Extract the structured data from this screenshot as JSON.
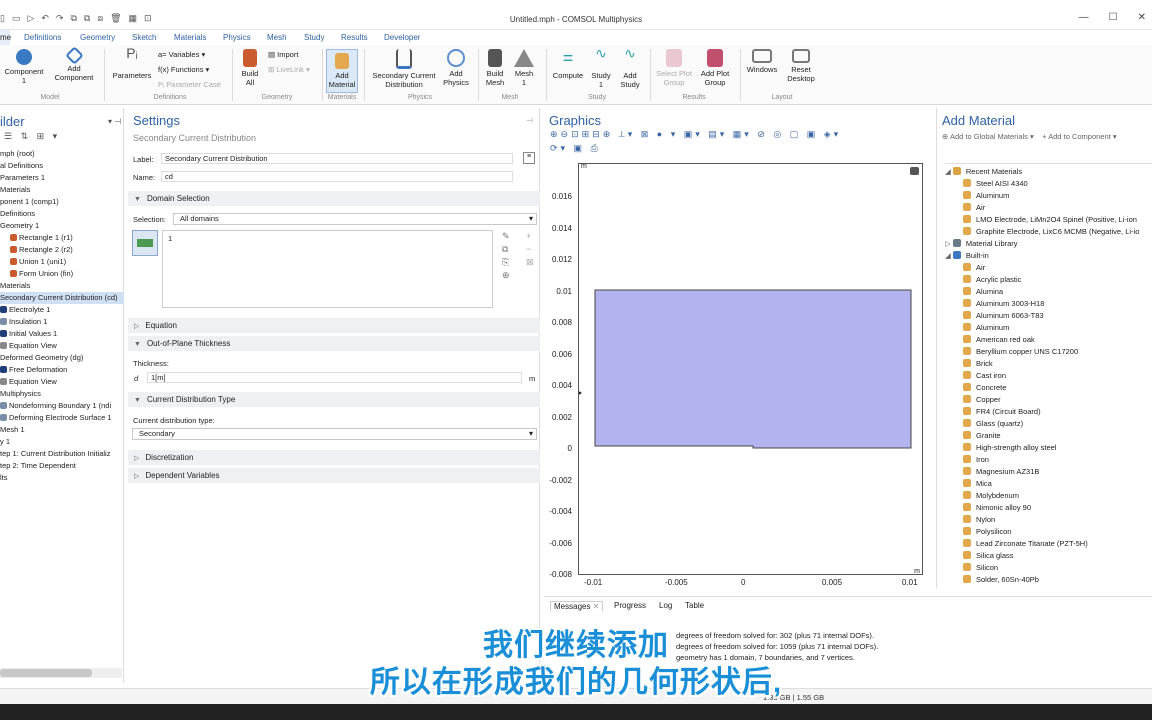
{
  "app": {
    "window_title": "Untitled.mph - COMSOL Multiphysics"
  },
  "menu": {
    "tabs": [
      "me",
      "Definitions",
      "Geometry",
      "Sketch",
      "Materials",
      "Physics",
      "Mesh",
      "Study",
      "Results",
      "Developer"
    ]
  },
  "ribbon": {
    "component": "Component\n1",
    "add_component": "Add\nComponent",
    "parameters": "Parameters",
    "variables": "Variables",
    "functions": "Functions",
    "parameter_case": "Parameter Case",
    "build_all": "Build\nAll",
    "import": "Import",
    "livelink": "LiveLink",
    "add_material": "Add\nMaterial",
    "secondary_current": "Secondary Current\nDistribution",
    "add_physics": "Add\nPhysics",
    "build_mesh": "Build\nMesh",
    "mesh1": "Mesh\n1",
    "compute": "Compute",
    "study1": "Study\n1",
    "add_study": "Add\nStudy",
    "select_plot_group": "Select Plot\nGroup",
    "add_plot_group": "Add Plot\nGroup",
    "windows": "Windows",
    "reset_desktop": "Reset\nDesktop",
    "groups": [
      "Model",
      "Definitions",
      "Geometry",
      "Materials",
      "Physics",
      "Mesh",
      "Study",
      "Results",
      "Layout"
    ]
  },
  "builder": {
    "title": "ilder",
    "tree": [
      {
        "text": "mph (root)"
      },
      {
        "text": "al Definitions"
      },
      {
        "text": "Parameters 1"
      },
      {
        "text": "Materials"
      },
      {
        "text": "ponent 1 (comp1)"
      },
      {
        "text": "Definitions"
      },
      {
        "text": "Geometry 1"
      },
      {
        "text": "Rectangle 1 (r1)"
      },
      {
        "text": "Rectangle 2 (r2)"
      },
      {
        "text": "Union 1 (uni1)"
      },
      {
        "text": "Form Union (fin)"
      },
      {
        "text": "Materials"
      },
      {
        "text": "Secondary Current Distribution (cd)",
        "selected": true
      },
      {
        "text": "Electrolyte 1"
      },
      {
        "text": "Insulation 1"
      },
      {
        "text": "Initial Values 1"
      },
      {
        "text": "Equation View"
      },
      {
        "text": "Deformed Geometry (dg)"
      },
      {
        "text": "Free Deformation"
      },
      {
        "text": "Equation View"
      },
      {
        "text": "Multiphysics"
      },
      {
        "text": "Nondeforming Boundary 1 (ndi"
      },
      {
        "text": "Deforming Electrode Surface 1"
      },
      {
        "text": "Mesh 1"
      },
      {
        "text": "y 1"
      },
      {
        "text": "tep 1: Current Distribution Initializ"
      },
      {
        "text": "tep 2: Time Dependent"
      },
      {
        "text": "lts"
      }
    ]
  },
  "settings": {
    "title": "Settings",
    "subtitle": "Secondary Current Distribution",
    "label_label": "Label:",
    "label_value": "Secondary Current Distribution",
    "name_label": "Name:",
    "name_value": "cd",
    "domain_selection": "Domain Selection",
    "selection_label": "Selection:",
    "selection_value": "All domains",
    "selection_item": "1",
    "equation": "Equation",
    "thickness_section": "Out-of-Plane Thickness",
    "thickness_label": "Thickness:",
    "thickness_symbol": "d",
    "thickness_value": "1[m]",
    "thickness_unit": "m",
    "cdt_section": "Current Distribution Type",
    "cdt_label": "Current distribution type:",
    "cdt_value": "Secondary",
    "discretization": "Discretization",
    "dependent_variables": "Dependent Variables"
  },
  "graphics": {
    "title": "Graphics",
    "axis_unit_y": "m",
    "axis_unit_x": "m",
    "y_ticks": [
      "0.016",
      "0.014",
      "0.012",
      "0.01",
      "0.008",
      "0.006",
      "0.004",
      "0.002",
      "0",
      "-0.002",
      "-0.004",
      "-0.006",
      "-0.008"
    ],
    "x_ticks": [
      "-0.01",
      "-0.005",
      "0",
      "0.005",
      "0.01"
    ],
    "domain_color": "#b3b3f0"
  },
  "add_material": {
    "title": "Add Material",
    "add_global": "Add to Global Materials",
    "add_component": "Add to Component",
    "recent_header": "Recent Materials",
    "recent": [
      "Steel AISI 4340",
      "Aluminum",
      "Air",
      "LMO Electrode, LiMn2O4 Spinel (Positive, Li-ion",
      "Graphite Electrode, LixC6 MCMB (Negative, Li-io"
    ],
    "library": "Material Library",
    "builtin_header": "Built-in",
    "builtin": [
      "Air",
      "Acrylic plastic",
      "Alumina",
      "Aluminum 3003-H18",
      "Aluminum 6063-T83",
      "Aluminum",
      "American red oak",
      "Beryllium copper UNS C17200",
      "Brick",
      "Cast iron",
      "Concrete",
      "Copper",
      "FR4 (Circuit Board)",
      "Glass (quartz)",
      "Granite",
      "High-strength alloy steel",
      "Iron",
      "Magnesium AZ31B",
      "Mica",
      "Molybdenum",
      "Nimonic alloy 90",
      "Nylon",
      "Polysilicon",
      "Lead Zirconate Titanate (PZT-5H)",
      "Silica glass",
      "Silicon",
      "Solder, 60Sn-40Pb"
    ]
  },
  "messages": {
    "tabs": [
      "Messages",
      "Progress",
      "Log",
      "Table"
    ],
    "lines": [
      "degrees of freedom solved for: 302 (plus 71 internal DOFs).",
      "degrees of freedom solved for: 1059 (plus 71 internal DOFs).",
      "geometry has 1 domain, 7 boundaries, and 7 vertices."
    ]
  },
  "status": {
    "memory": "1.36 GB | 1.55 GB"
  },
  "subtitles": {
    "line1": "我们继续添加",
    "line2": "所以在形成我们的几何形状后,"
  }
}
